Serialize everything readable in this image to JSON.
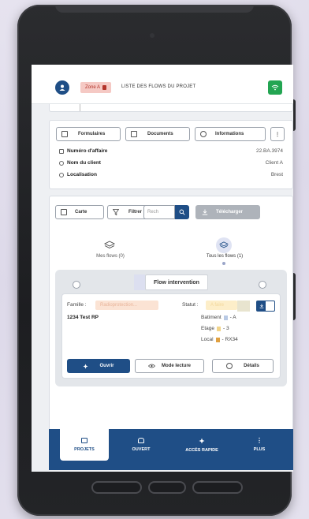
{
  "header": {
    "zone_label": "Zone A",
    "title": "LISTE DES FLOWS DU PROJET"
  },
  "toolbar": {
    "formulaires": "Formulaires",
    "documents": "Documents",
    "informations": "Informations",
    "more": "⋮"
  },
  "info": {
    "numero_label": "Numéro d'affaire",
    "numero_value": "22.BA.3974",
    "client_label": "Nom du client",
    "client_value": "Client A",
    "localisation_label": "Localisation",
    "localisation_value": "Brest"
  },
  "controls": {
    "carte": "Carte",
    "filtrer": "Filtrer",
    "search_placeholder": "Rech",
    "telecharger": "Télécharger"
  },
  "tabs": {
    "mes_flows": "Mes flows (0)",
    "tous_flows": "Tous les flows (1)"
  },
  "flow": {
    "title": "Flow intervention",
    "famille_label": "Famille :",
    "famille_value": "Radioprotection...",
    "statut_label": "Statut :",
    "statut_value": "A faire",
    "name": "1234 Test RP",
    "batiment_label": "Batiment",
    "batiment_value": "- A",
    "etage_label": "Etage",
    "etage_value": "- 3",
    "local_label": "Local",
    "local_value": "- RX34",
    "ouvrir": "Ouvrir",
    "mode_lecture": "Mode lecture",
    "details": "Détails"
  },
  "nav": {
    "projets": "PROJETS",
    "ouvert": "OUVERT",
    "acces_rapide": "ACCÈS RAPIDE",
    "plus": "PLUS"
  },
  "colors": {
    "primary": "#1f4e86",
    "wifi": "#23a552",
    "zone_badge": "#f5c9c4",
    "statut_tag": "#fdeec9",
    "famille_tag": "#fbe3d4"
  }
}
